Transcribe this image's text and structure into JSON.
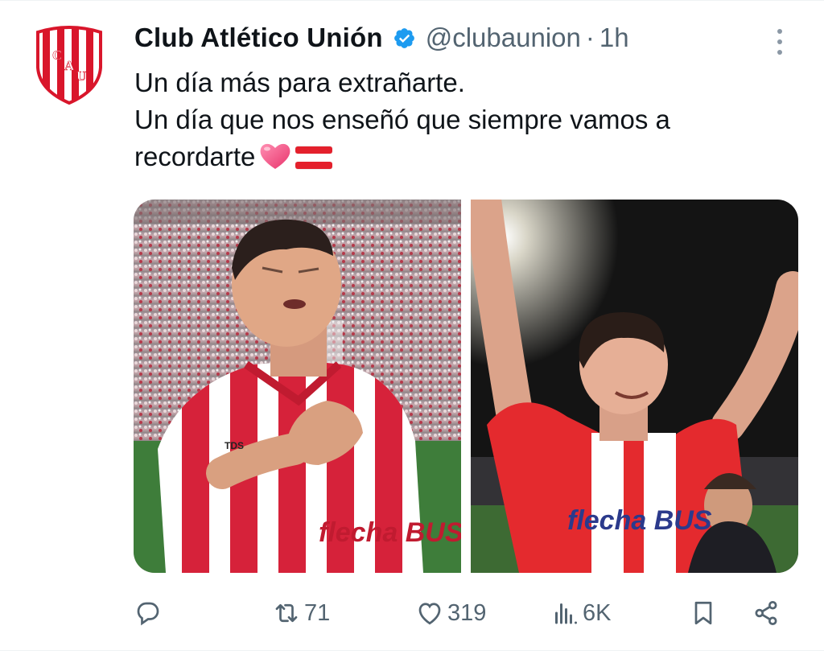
{
  "tweet": {
    "author_name": "Club Atlético Unión",
    "handle": "@clubaunion",
    "separator": "·",
    "time": "1h",
    "text_lines": [
      "Un día más para extrañarte.",
      "Un día que nos enseñó que siempre vamos a",
      "recordarte"
    ],
    "avatar_letters": [
      "C",
      "A",
      "U"
    ],
    "shirt_sponsor": "flecha BUS",
    "shirt_brand": "TDS"
  },
  "actions": {
    "reply_count": "",
    "retweet_count": "71",
    "like_count": "319",
    "views_count": "6K"
  },
  "icons": [
    "verified-badge-icon",
    "more-options-icon",
    "heart-emoji-icon",
    "flag-emoji-icon",
    "reply-icon",
    "retweet-icon",
    "like-icon",
    "views-icon",
    "bookmark-icon",
    "share-icon"
  ],
  "colors": {
    "verified": "#1d9bf0",
    "club_red": "#d9162b",
    "muted": "#536471"
  }
}
